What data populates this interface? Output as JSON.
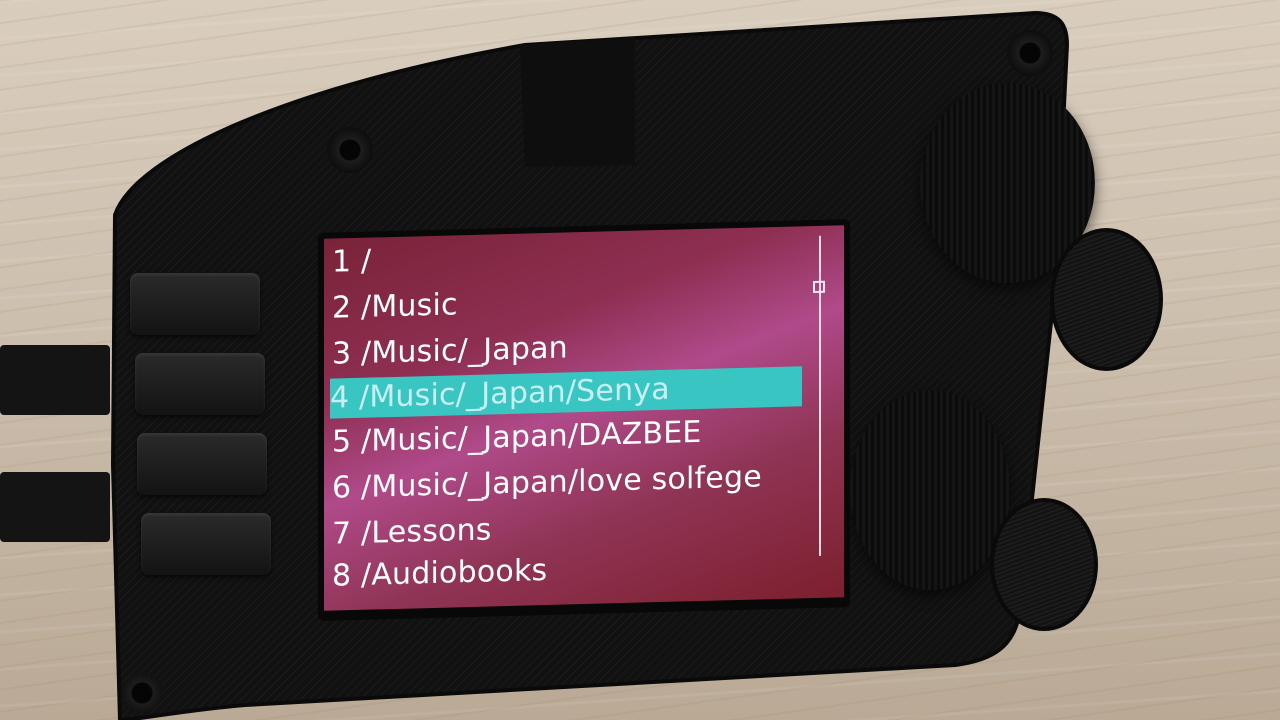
{
  "device": {
    "screen": {
      "colors": {
        "background": "#8e2f52",
        "text": "#ffffff",
        "selection": "#39c6c3",
        "selected_text": "#c9eef1"
      },
      "selected_index": 3,
      "items": [
        {
          "label": "1 /"
        },
        {
          "label": "2 /Music"
        },
        {
          "label": "3 /Music/_Japan"
        },
        {
          "label": "4 /Music/_Japan/Senya"
        },
        {
          "label": "5 /Music/_Japan/DAZBEE"
        },
        {
          "label": "6 /Music/_Japan/love solfege"
        },
        {
          "label": "7 /Lessons"
        },
        {
          "label": "8 /Audiobooks"
        }
      ]
    },
    "icons": [
      "side-button-icon",
      "rotary-knob-icon",
      "screw-icon"
    ]
  }
}
